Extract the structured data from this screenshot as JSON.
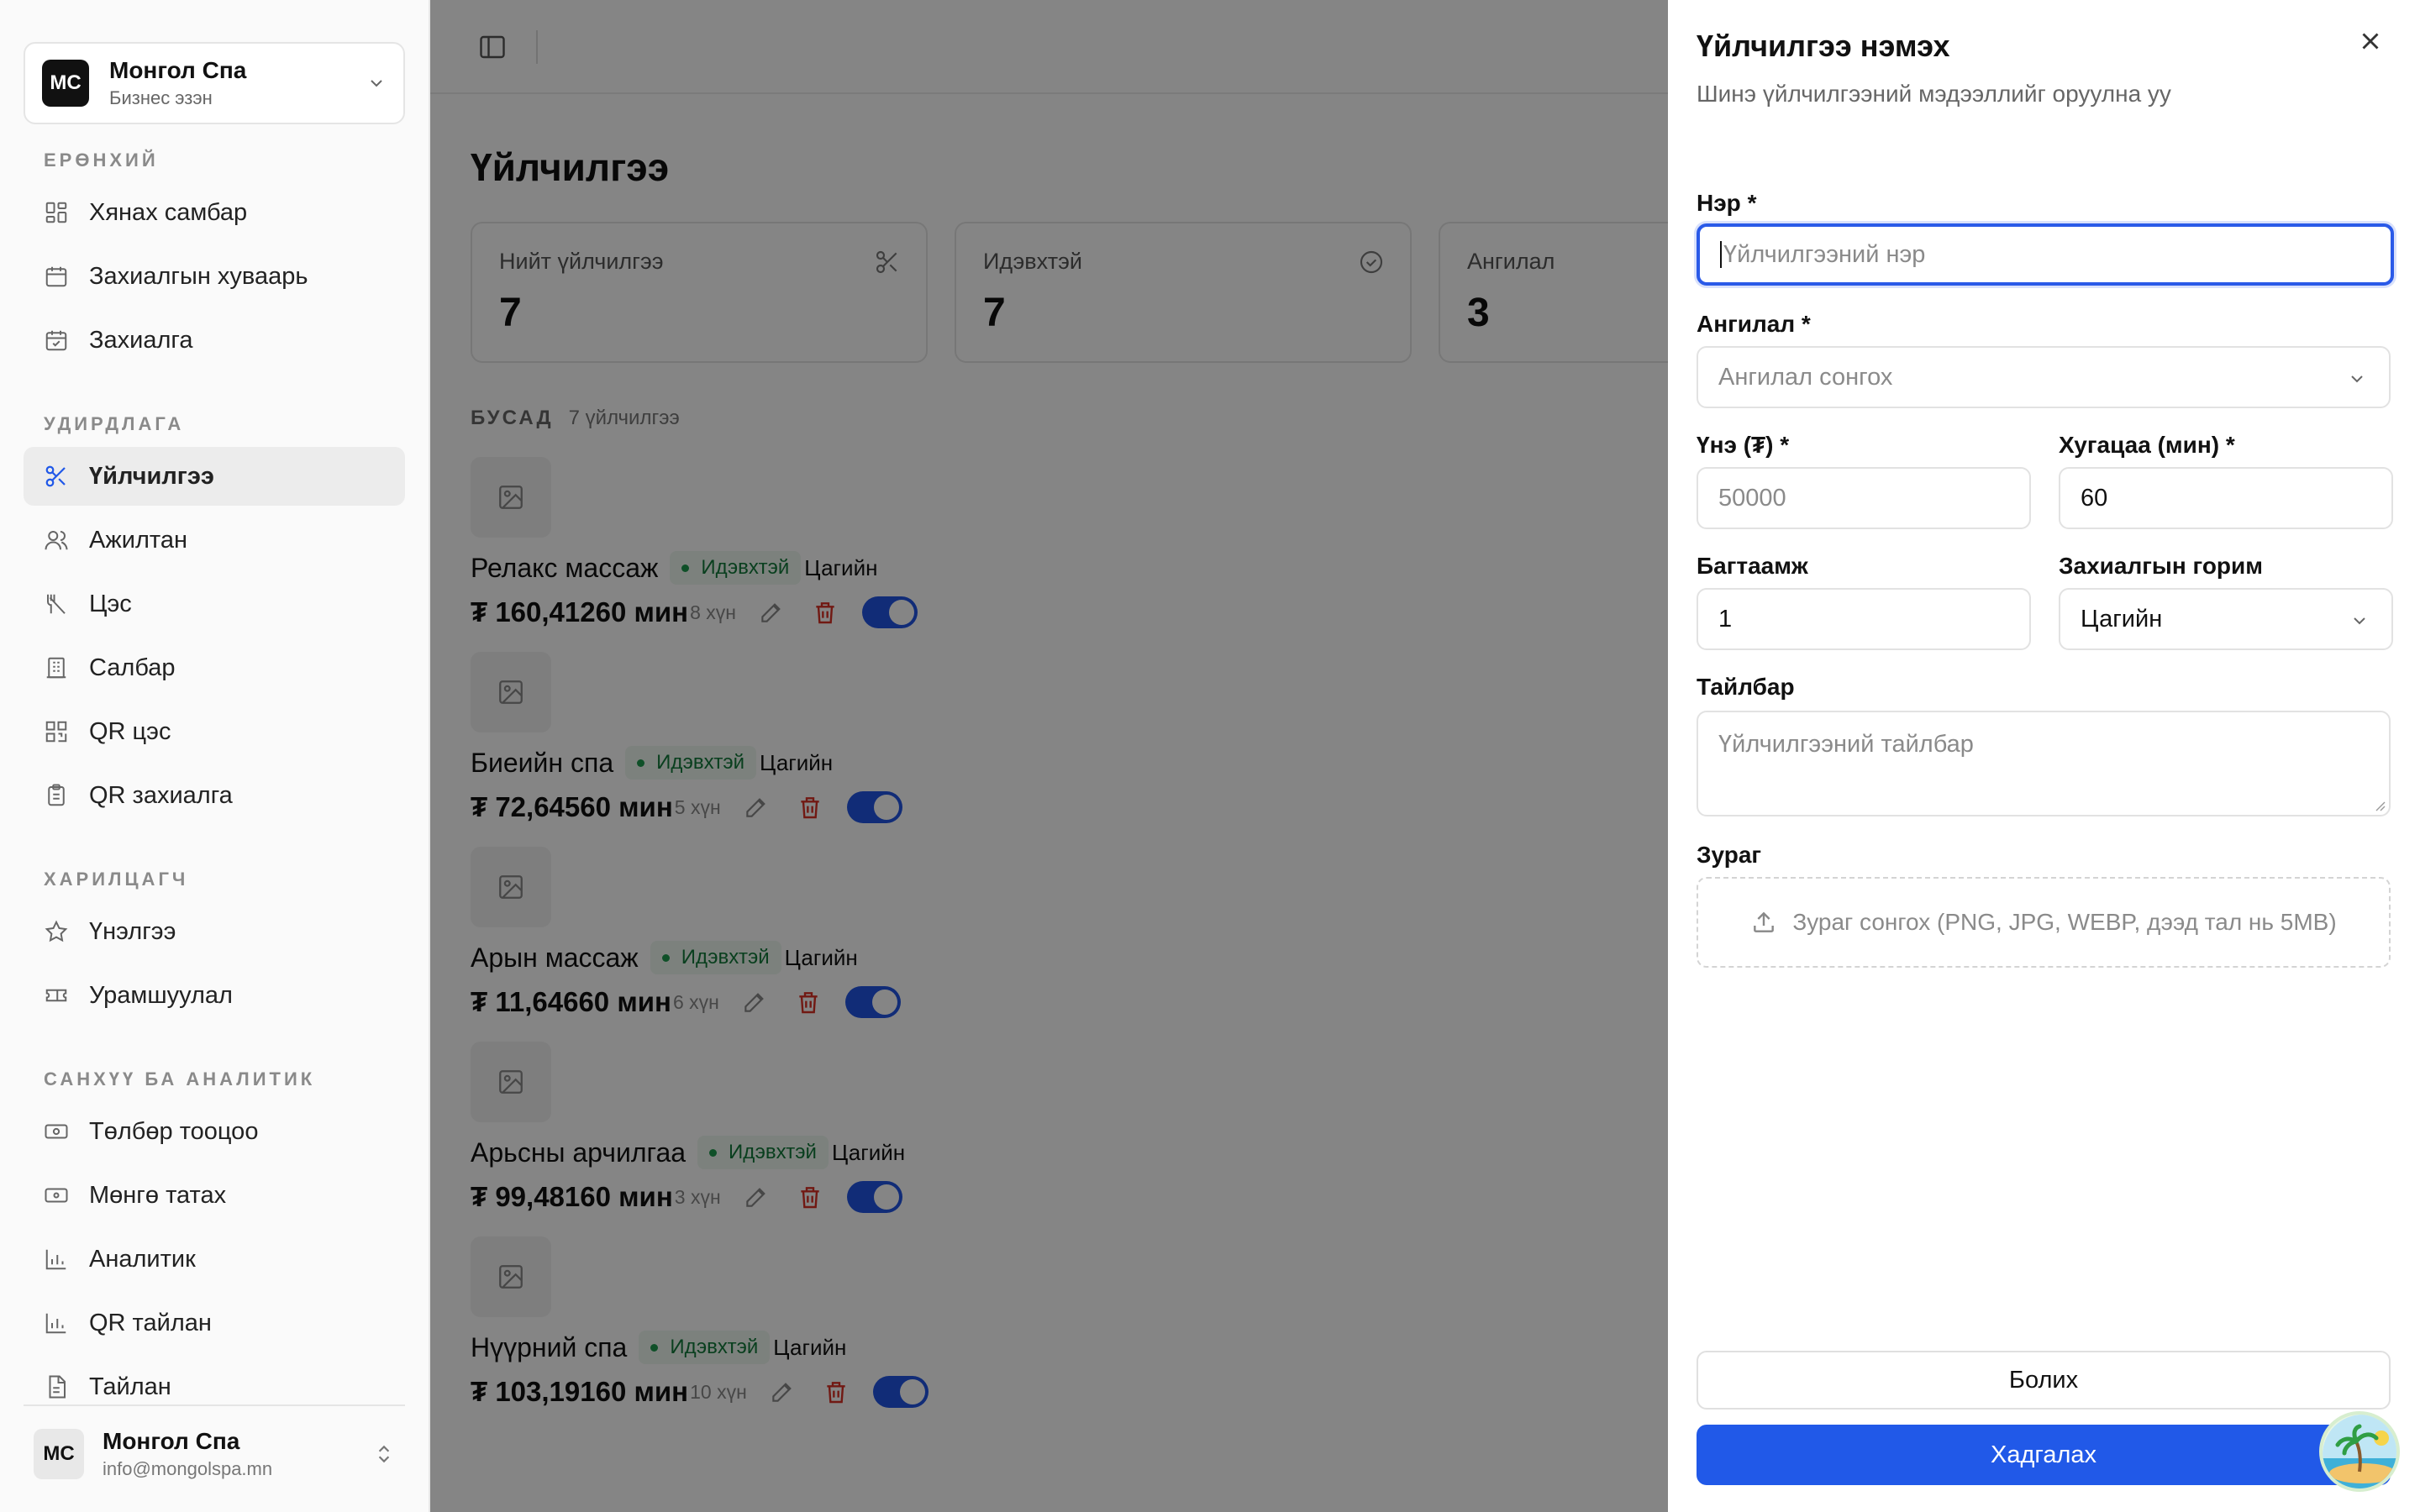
{
  "workspace": {
    "avatar": "MC",
    "name": "Монгол Спа",
    "role": "Бизнес эзэн"
  },
  "sidebar": {
    "sections": [
      {
        "label": "ЕРӨНХИЙ",
        "items": [
          {
            "label": "Хянах самбар",
            "icon": "dashboard-icon"
          },
          {
            "label": "Захиалгын хуваарь",
            "icon": "calendar-icon"
          },
          {
            "label": "Захиалга",
            "icon": "calendar-check-icon"
          }
        ]
      },
      {
        "label": "УДИРДЛАГА",
        "items": [
          {
            "label": "Үйлчилгээ",
            "icon": "scissors-icon",
            "active": true
          },
          {
            "label": "Ажилтан",
            "icon": "users-icon"
          },
          {
            "label": "Цэс",
            "icon": "utensils-icon"
          },
          {
            "label": "Салбар",
            "icon": "building-icon"
          },
          {
            "label": "QR цэс",
            "icon": "qr-icon"
          },
          {
            "label": "QR захиалга",
            "icon": "clipboard-icon"
          }
        ]
      },
      {
        "label": "ХАРИЛЦАГЧ",
        "items": [
          {
            "label": "Үнэлгээ",
            "icon": "star-icon"
          },
          {
            "label": "Урамшуулал",
            "icon": "ticket-icon"
          }
        ]
      },
      {
        "label": "САНХҮҮ БА АНАЛИТИК",
        "items": [
          {
            "label": "Төлбөр тооцоо",
            "icon": "banknote-icon"
          },
          {
            "label": "Мөнгө татах",
            "icon": "wallet-icon"
          },
          {
            "label": "Аналитик",
            "icon": "bar-chart-icon"
          },
          {
            "label": "QR тайлан",
            "icon": "bar-chart-icon"
          },
          {
            "label": "Тайлан",
            "icon": "file-icon"
          }
        ]
      }
    ],
    "footer": {
      "avatar": "MC",
      "name": "Монгол Спа",
      "email": "info@mongolspa.mn"
    }
  },
  "main": {
    "title": "Үйлчилгээ",
    "stats": [
      {
        "label": "Нийт үйлчилгээ",
        "value": "7",
        "icon": "scissors-icon"
      },
      {
        "label": "Идэвхтэй",
        "value": "7",
        "icon": "check-circle-icon"
      },
      {
        "label": "Ангилал",
        "value": "3",
        "icon": ""
      }
    ],
    "group": {
      "label": "БУСАД",
      "count": "7 үйлчилгээ"
    },
    "services": [
      {
        "name": "Релакс массаж",
        "status": "Идэвхтэй",
        "type": "Цагийн",
        "price": "₮ 160,41260 мин",
        "capacity": "8 хүн",
        "enabled": true
      },
      {
        "name": "Биеийн спа",
        "status": "Идэвхтэй",
        "type": "Цагийн",
        "price": "₮ 72,64560 мин",
        "capacity": "5 хүн",
        "enabled": true
      },
      {
        "name": "Арын массаж",
        "status": "Идэвхтэй",
        "type": "Цагийн",
        "price": "₮ 11,64660 мин",
        "capacity": "6 хүн",
        "enabled": true
      },
      {
        "name": "Арьсны арчилгаа",
        "status": "Идэвхтэй",
        "type": "Цагийн",
        "price": "₮ 99,48160 мин",
        "capacity": "3 хүн",
        "enabled": true
      },
      {
        "name": "Нүүрний спа",
        "status": "Идэвхтэй",
        "type": "Цагийн",
        "price": "₮ 103,19160 мин",
        "capacity": "10 хүн",
        "enabled": true
      }
    ]
  },
  "drawer": {
    "title": "Үйлчилгээ нэмэх",
    "subtitle": "Шинэ үйлчилгээний мэдээллийг оруулна уу",
    "name": {
      "label": "Нэр *",
      "value": "",
      "placeholder": "Үйлчилгээний нэр"
    },
    "category": {
      "label": "Ангилал *",
      "placeholder": "Ангилал сонгох"
    },
    "price": {
      "label": "Үнэ (₮) *",
      "placeholder": "50000"
    },
    "duration": {
      "label": "Хугацаа (мин) *",
      "value": "60"
    },
    "capacity": {
      "label": "Багтаамж",
      "value": "1"
    },
    "booking_mode": {
      "label": "Захиалгын горим",
      "value": "Цагийн"
    },
    "description": {
      "label": "Тайлбар",
      "placeholder": "Үйлчилгээний тайлбар"
    },
    "image": {
      "label": "Зураг",
      "upload_text": "Зураг сонгох (PNG, JPG, WEBP, дээд тал нь 5MB)"
    },
    "cancel_label": "Болих",
    "save_label": "Хадгалах"
  },
  "colors": {
    "primary": "#2159e8",
    "active_badge": "#137a3b",
    "danger": "#d93025"
  }
}
